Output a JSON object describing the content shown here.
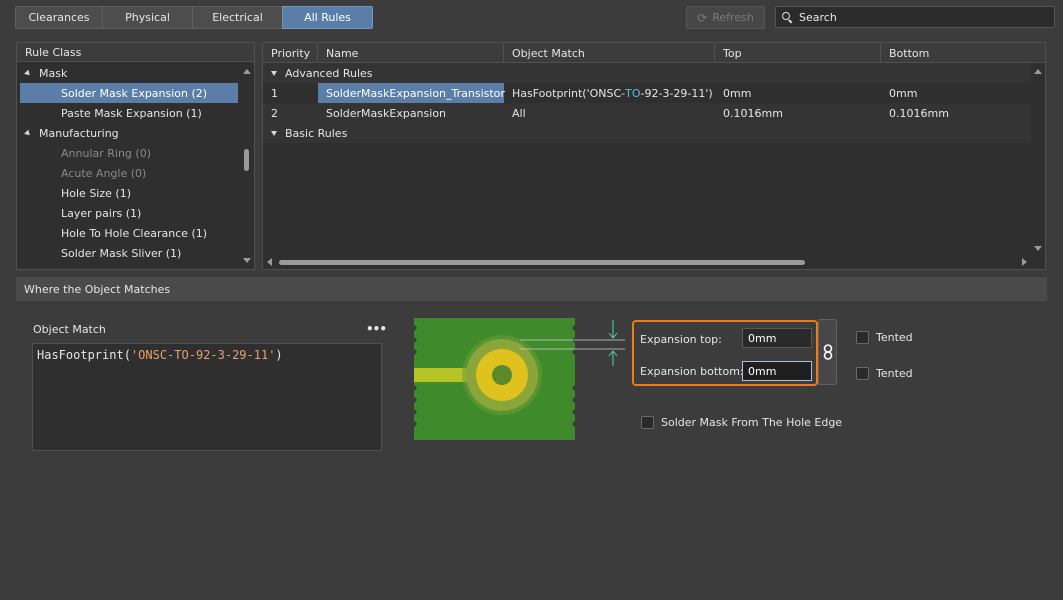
{
  "tabs": [
    {
      "label": "Clearances",
      "active": false
    },
    {
      "label": "Physical",
      "active": false
    },
    {
      "label": "Electrical",
      "active": false
    },
    {
      "label": "All Rules",
      "active": true
    }
  ],
  "toolbar": {
    "refresh_label": "Refresh",
    "refresh_icon": "refresh-icon",
    "search_placeholder": "Search"
  },
  "rule_class": {
    "header": "Rule Class",
    "groups": [
      {
        "label": "Mask",
        "items": [
          {
            "label": "Solder Mask Expansion (2)",
            "selected": true,
            "disabled": false
          },
          {
            "label": "Paste Mask Expansion (1)",
            "selected": false,
            "disabled": false
          }
        ]
      },
      {
        "label": "Manufacturing",
        "items": [
          {
            "label": "Annular Ring (0)",
            "selected": false,
            "disabled": true
          },
          {
            "label": "Acute Angle (0)",
            "selected": false,
            "disabled": true
          },
          {
            "label": "Hole Size (1)",
            "selected": false,
            "disabled": false
          },
          {
            "label": "Layer pairs (1)",
            "selected": false,
            "disabled": false
          },
          {
            "label": "Hole To Hole Clearance (1)",
            "selected": false,
            "disabled": false
          },
          {
            "label": "Solder Mask Sliver (1)",
            "selected": false,
            "disabled": false
          }
        ]
      }
    ]
  },
  "rules_grid": {
    "columns": [
      "Priority",
      "Name",
      "Object Match",
      "Top",
      "Bottom"
    ],
    "sections": [
      {
        "label": "Advanced Rules",
        "rows": [
          {
            "priority": "1",
            "name": "SolderMaskExpansion_Transistor",
            "match_prefix": "HasFootprint('ONSC-",
            "match_highlight": "TO",
            "match_suffix": "-92-3-29-11')",
            "top": "0mm",
            "bottom": "0mm",
            "selected": true
          },
          {
            "priority": "2",
            "name": "SolderMaskExpansion",
            "match_prefix": "All",
            "match_highlight": "",
            "match_suffix": "",
            "top": "0.1016mm",
            "bottom": "0.1016mm",
            "selected": false
          }
        ]
      },
      {
        "label": "Basic Rules",
        "rows": []
      }
    ]
  },
  "where_section": {
    "title": "Where the Object Matches",
    "object_match_label": "Object Match",
    "more_icon": "more-options-icon",
    "query_prefix": "HasFootprint(",
    "query_string": "'ONSC-TO-92-3-29-11'",
    "query_suffix": ")"
  },
  "expansion": {
    "top_label": "Expansion top:",
    "top_value": "0mm",
    "bottom_label": "Expansion bottom:",
    "bottom_value": "0mm",
    "link_icon": "link-icon",
    "tented_top_label": "Tented",
    "tented_bottom_label": "Tented",
    "hole_edge_label": "Solder Mask From The Hole Edge"
  },
  "colors": {
    "accent": "#5a7ea8",
    "highlight_border": "#f07a12",
    "pcb_green": "#3f8a2a",
    "pad_yellow": "#d8c020"
  }
}
